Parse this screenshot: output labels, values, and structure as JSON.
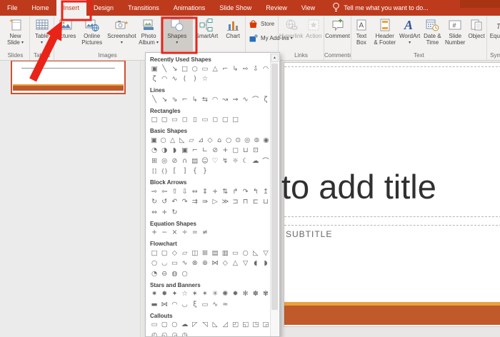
{
  "colors": {
    "titlebar": "#BE3A1D",
    "ribbon_bg": "#F2F1F0",
    "annotation_red": "#EA2318",
    "slide_accent_dark": "#C05A2B",
    "slide_accent_light": "#E9A23B",
    "thumbnail_border": "#CF5030"
  },
  "menubar": {
    "tabs": [
      "File",
      "Home",
      "Insert",
      "Design",
      "Transitions",
      "Animations",
      "Slide Show",
      "Review",
      "View"
    ],
    "active_tab": "Insert",
    "tellme": {
      "icon": "lightbulb-icon",
      "label": "Tell me what you want to do..."
    }
  },
  "ribbon": {
    "groups": [
      {
        "label": "Slides",
        "buttons": [
          {
            "name": "new-slide",
            "label": "New\nSlide",
            "icon": "new-slide-icon",
            "caret": true
          }
        ]
      },
      {
        "label": "Tables",
        "buttons": [
          {
            "name": "table",
            "label": "Table",
            "icon": "table-icon",
            "caret": true
          }
        ]
      },
      {
        "label": "Images",
        "buttons": [
          {
            "name": "pictures",
            "label": "Pictures",
            "icon": "pictures-icon"
          },
          {
            "name": "online-pictures",
            "label": "Online\nPictures",
            "icon": "online-pictures-icon"
          },
          {
            "name": "screenshot",
            "label": "Screenshot",
            "icon": "screenshot-icon",
            "caret": true
          },
          {
            "name": "photo-album",
            "label": "Photo\nAlbum",
            "icon": "photo-album-icon",
            "caret": true
          }
        ]
      },
      {
        "label": "",
        "buttons": [
          {
            "name": "shapes",
            "label": "Shapes",
            "icon": "shapes-icon",
            "caret": true,
            "active": true
          },
          {
            "name": "smartart",
            "label": "SmartArt",
            "icon": "smartart-icon"
          },
          {
            "name": "chart",
            "label": "Chart",
            "icon": "chart-icon"
          }
        ]
      },
      {
        "label": "",
        "stack": true,
        "buttons": [
          {
            "name": "store",
            "label": "Store",
            "icon": "store-icon"
          },
          {
            "name": "my-add-ins",
            "label": "My Add-ins",
            "icon": "my-add-ins-icon",
            "caret": true
          }
        ]
      },
      {
        "label": "Links",
        "buttons": [
          {
            "name": "hyperlink",
            "label": "Hyperlink",
            "icon": "hyperlink-icon",
            "disabled": true
          },
          {
            "name": "action",
            "label": "Action",
            "icon": "action-icon",
            "disabled": true
          }
        ]
      },
      {
        "label": "Comments",
        "buttons": [
          {
            "name": "comment",
            "label": "Comment",
            "icon": "comment-icon"
          }
        ]
      },
      {
        "label": "Text",
        "buttons": [
          {
            "name": "text-box",
            "label": "Text\nBox",
            "icon": "text-box-icon"
          },
          {
            "name": "header-footer",
            "label": "Header\n& Footer",
            "icon": "header-footer-icon"
          },
          {
            "name": "wordart",
            "label": "WordArt",
            "icon": "wordart-icon",
            "caret": true
          },
          {
            "name": "date-time",
            "label": "Date &\nTime",
            "icon": "date-time-icon"
          },
          {
            "name": "slide-number",
            "label": "Slide\nNumber",
            "icon": "slide-number-icon"
          },
          {
            "name": "object",
            "label": "Object",
            "icon": "object-icon"
          }
        ]
      },
      {
        "label": "Symbols",
        "buttons": [
          {
            "name": "equation",
            "label": "Equation",
            "icon": "equation-icon",
            "caret": true
          }
        ]
      }
    ]
  },
  "shapes_menu": {
    "sections": [
      {
        "title": "Recently Used Shapes",
        "rows": [
          [
            "▣",
            "╲",
            "↘",
            "□",
            "○",
            "▭",
            "△",
            "⌐",
            "↳",
            "⇨",
            "⇩",
            "◠"
          ],
          [
            "ζ",
            "◠",
            "∿",
            "(",
            ")",
            "☆"
          ]
        ]
      },
      {
        "title": "Lines",
        "rows": [
          [
            "╲",
            "↘",
            "⇘",
            "⌐",
            "↳",
            "⇆",
            "◠",
            "↝",
            "⇝",
            "∿",
            "⌒",
            "ζ"
          ]
        ]
      },
      {
        "title": "Rectangles",
        "rows": [
          [
            "□",
            "▢",
            "▭",
            "◻",
            "▯",
            "▭",
            "◻",
            "▢",
            "□"
          ]
        ]
      },
      {
        "title": "Basic Shapes",
        "rows": [
          [
            "▣",
            "○",
            "△",
            "◺",
            "▱",
            "⊿",
            "◇",
            "⌂",
            "○",
            "⊙",
            "◎",
            "⊚",
            "◉"
          ],
          [
            "◔",
            "◑",
            "◗",
            "▣",
            "⌐",
            "∟",
            "⊘",
            "+",
            "▢",
            "⊔",
            "⊡"
          ],
          [
            "⊞",
            "◎",
            "⊘",
            "∩",
            "▤",
            "☺",
            "♡",
            "↯",
            "☼",
            "☾",
            "☁",
            "⌒"
          ],
          [
            "[]",
            "{}",
            "[",
            "]",
            "{",
            "}"
          ]
        ]
      },
      {
        "title": "Block Arrows",
        "rows": [
          [
            "⇨",
            "⇦",
            "⇧",
            "⇩",
            "⇔",
            "⇕",
            "+",
            "⇅",
            "↱",
            "↷",
            "↰",
            "↥"
          ],
          [
            "↻",
            "↺",
            "↶",
            "↷",
            "⇉",
            "⇛",
            "▷",
            "≫",
            "⊐",
            "⊓",
            "⊏",
            "⊔"
          ],
          [
            "⇔",
            "+",
            "↻"
          ]
        ]
      },
      {
        "title": "Equation Shapes",
        "rows": [
          [
            "+",
            "−",
            "×",
            "÷",
            "=",
            "≠"
          ]
        ]
      },
      {
        "title": "Flowchart",
        "rows": [
          [
            "□",
            "▢",
            "◇",
            "▱",
            "◫",
            "⊞",
            "▤",
            "▥",
            "▭",
            "○",
            "◺",
            "▽"
          ],
          [
            "○",
            "◡",
            "▭",
            "∿",
            "⊗",
            "⊕",
            "⋈",
            "◇",
            "△",
            "▽",
            "◖",
            "◗"
          ],
          [
            "◔",
            "⊖",
            "◍",
            "○"
          ]
        ]
      },
      {
        "title": "Stars and Banners",
        "rows": [
          [
            "✷",
            "✸",
            "✦",
            "☆",
            "✶",
            "✴",
            "✳",
            "✺",
            "✹",
            "✻",
            "✽",
            "✾"
          ],
          [
            "▬",
            "⋈",
            "◠",
            "◡",
            "ξ",
            "▭",
            "∿",
            "≈"
          ]
        ]
      },
      {
        "title": "Callouts",
        "rows": [
          [
            "▭",
            "▢",
            "○",
            "☁",
            "◸",
            "◹",
            "◺",
            "◿",
            "◰",
            "◱",
            "◳",
            "◲"
          ],
          [
            "◴",
            "◵",
            "◶",
            "◷"
          ]
        ]
      }
    ]
  },
  "slides_panel": {
    "selected_slide": 1
  },
  "canvas": {
    "title_text": "to add title",
    "subtitle_text": "SUBTITLE"
  }
}
